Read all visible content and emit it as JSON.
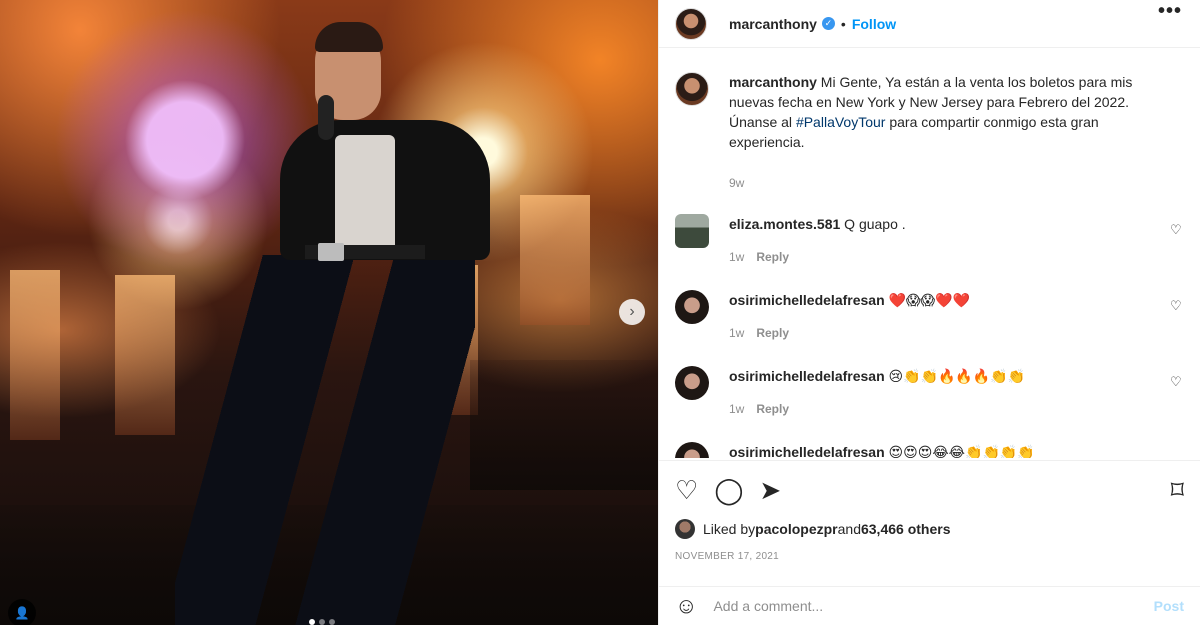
{
  "post": {
    "username": "marcanthony",
    "verified_mark": "✓",
    "separator": "•",
    "follow_label": "Follow",
    "more_icon": "•••",
    "next_icon": "›",
    "tag_icon": "👤"
  },
  "caption": {
    "username": "marcanthony",
    "text_before": " Mi Gente, Ya están a la venta los boletos para mis nuevas fecha en New York y New Jersey para Febrero del 2022. Únanse al ",
    "hashtag": "#PallaVoyTour",
    "text_after": " para compartir conmigo esta gran experiencia.",
    "time": "9w"
  },
  "comments": [
    {
      "username": "eliza.montes.581",
      "text": " Q guapo .",
      "time": "1w",
      "reply_label": "Reply"
    },
    {
      "username": "osirimichelledelafresan",
      "text": " ❤️😱😱❤️❤️",
      "time": "1w",
      "reply_label": "Reply"
    },
    {
      "username": "osirimichelledelafresan",
      "text": " 😢👏👏🔥🔥🔥👏👏",
      "time": "1w",
      "reply_label": "Reply"
    },
    {
      "username": "osirimichelledelafresan",
      "text": " 😍😍😍😂😂👏👏👏👏",
      "time": "",
      "reply_label": ""
    }
  ],
  "actions": {
    "like_icon": "♡",
    "comment_icon": "◯",
    "share_icon": "➤",
    "save_icon": "⌑"
  },
  "likes": {
    "prefix": "Liked by ",
    "user": "pacolopezpr",
    "middle": " and ",
    "count": "63,466 others"
  },
  "date": "NOVEMBER 17, 2021",
  "add_comment": {
    "emoji_icon": "☺",
    "placeholder": "Add a comment...",
    "post_label": "Post"
  }
}
